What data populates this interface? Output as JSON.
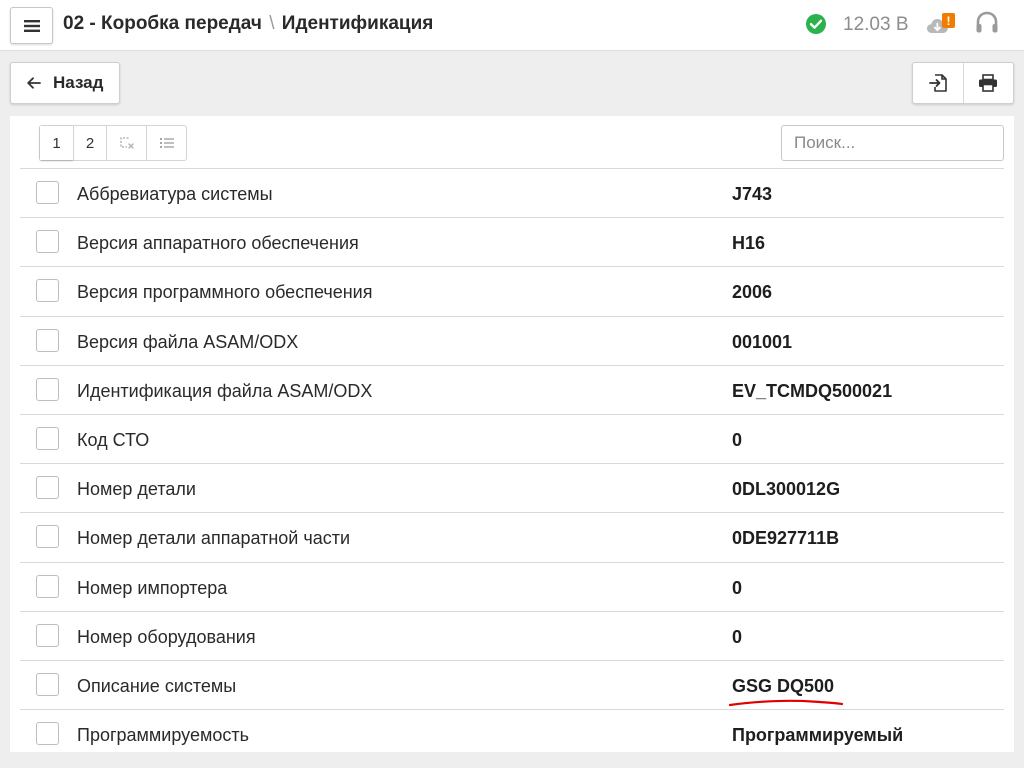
{
  "header": {
    "title_main": "02 - Коробка передач",
    "title_separator": "\\",
    "title_sub": "Идентификация",
    "voltage": "12.03 В",
    "cloud_badge": "!"
  },
  "toolbar": {
    "back_label": "Назад"
  },
  "pager": {
    "pages": [
      "1",
      "2"
    ]
  },
  "search": {
    "placeholder": "Поиск..."
  },
  "rows": [
    {
      "label": "Аббревиатура системы",
      "value": "J743"
    },
    {
      "label": "Версия аппаратного обеспечения",
      "value": "H16"
    },
    {
      "label": "Версия программного обеспечения",
      "value": "2006"
    },
    {
      "label": "Версия файла ASAM/ODX",
      "value": "001001"
    },
    {
      "label": "Идентификация файла ASAM/ODX",
      "value": "EV_TCMDQ500021"
    },
    {
      "label": "Код СТО",
      "value": "0"
    },
    {
      "label": "Номер детали",
      "value": "0DL300012G"
    },
    {
      "label": "Номер детали аппаратной части",
      "value": "0DE927711B"
    },
    {
      "label": "Номер импортера",
      "value": "0"
    },
    {
      "label": "Номер оборудования",
      "value": "0"
    },
    {
      "label": "Описание системы",
      "value": "GSG DQ500"
    },
    {
      "label": "Программируемость",
      "value": "Программируемый"
    }
  ],
  "colors": {
    "status_ok": "#2bb24c",
    "alert_badge": "#f07d00",
    "annotation_red": "#e00000"
  },
  "icons": {
    "menu": "hamburger-icon",
    "status": "check-circle-icon",
    "cloud": "cloud-alert-icon",
    "support": "headset-icon",
    "back": "arrow-left-icon",
    "export": "export-file-icon",
    "print": "printer-icon",
    "clear_selection": "clear-selection-icon",
    "list": "list-icon"
  }
}
